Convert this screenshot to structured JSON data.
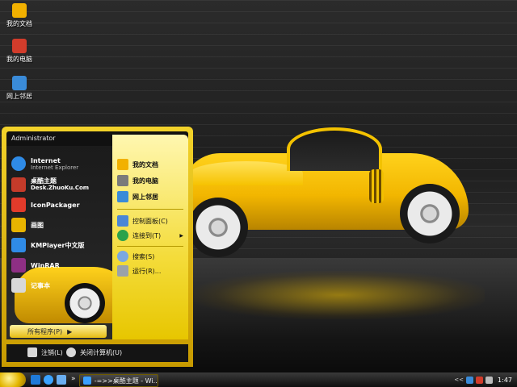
{
  "desktop": {
    "icons": [
      {
        "label": "我的文档",
        "icon": "my-documents-icon",
        "color": "#f2b100"
      },
      {
        "label": "我的电脑",
        "icon": "my-computer-icon",
        "color": "#d23c2b"
      },
      {
        "label": "网上邻居",
        "icon": "network-icon",
        "color": "#3a8bd8"
      }
    ]
  },
  "start_menu": {
    "user": "Administrator",
    "pinned": [
      {
        "title": "Internet",
        "subtitle": "Internet Explorer",
        "icon": "ie-icon",
        "color": "#2f8be6"
      },
      {
        "title": "桌酷主题",
        "subtitle": "Desk.ZhuoKu.Com",
        "icon": "zhuoku-icon",
        "color": "#c43b2a"
      }
    ],
    "programs": [
      {
        "title": "IconPackager",
        "icon": "iconpackager-icon",
        "color": "#e23b2b"
      },
      {
        "title": "画图",
        "icon": "paint-icon",
        "color": "#e8b400"
      },
      {
        "title": "KMPlayer中文版",
        "icon": "kmplayer-icon",
        "color": "#2f8be6"
      },
      {
        "title": "WinRAR",
        "icon": "winrar-icon",
        "color": "#8e2f84"
      },
      {
        "title": "记事本",
        "icon": "notepad-icon",
        "color": "#d8d8d8"
      }
    ],
    "all_programs": "所有程序(P)",
    "all_programs_arrow": "▶",
    "right": [
      {
        "label": "我的文档",
        "icon": "my-documents-icon",
        "color": "#f2b100",
        "bold": true
      },
      {
        "label": "我的电脑",
        "icon": "my-computer-icon",
        "color": "#7a7a7a",
        "bold": true
      },
      {
        "label": "网上邻居",
        "icon": "network-icon",
        "color": "#3a8bd8",
        "bold": true
      },
      {
        "label": "控制面板(C)",
        "icon": "control-panel-icon",
        "color": "#4b86d6",
        "bold": false
      },
      {
        "label": "连接到(T)",
        "icon": "connect-icon",
        "color": "#2aa24b",
        "bold": false,
        "arrow": "▶"
      },
      {
        "label": "搜索(S)",
        "icon": "search-icon",
        "color": "#7aa8e0",
        "bold": false
      },
      {
        "label": "运行(R)...",
        "icon": "run-icon",
        "color": "#9aa2aa",
        "bold": false
      }
    ],
    "logoff": "注销(L)",
    "shutdown": "关闭计算机(U)"
  },
  "taskbar": {
    "task_label": "-=>>桌酷主题 - Wi...",
    "quick_launch_arrow": "»",
    "tray_arrow": "<<",
    "clock": "1:47"
  },
  "colors": {
    "accent": "#f2c400",
    "menu_dark": "#1b1b1b"
  }
}
